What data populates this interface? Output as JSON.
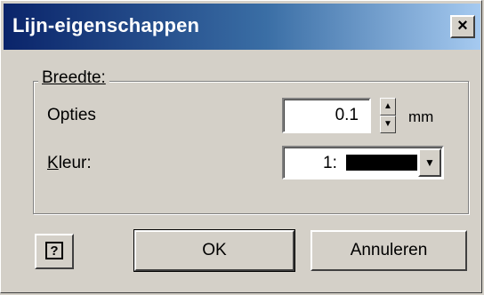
{
  "window": {
    "title": "Lijn-eigenschappen",
    "close_label": "×"
  },
  "group": {
    "label": "Breedte:",
    "opties_label": "Opties",
    "width_value": "0.1",
    "unit": "mm",
    "kleur_label": "Kleur:",
    "color_index": "1:",
    "color_value": "#000000"
  },
  "buttons": {
    "help_label": "?",
    "ok_label": "OK",
    "cancel_label": "Annuleren"
  }
}
